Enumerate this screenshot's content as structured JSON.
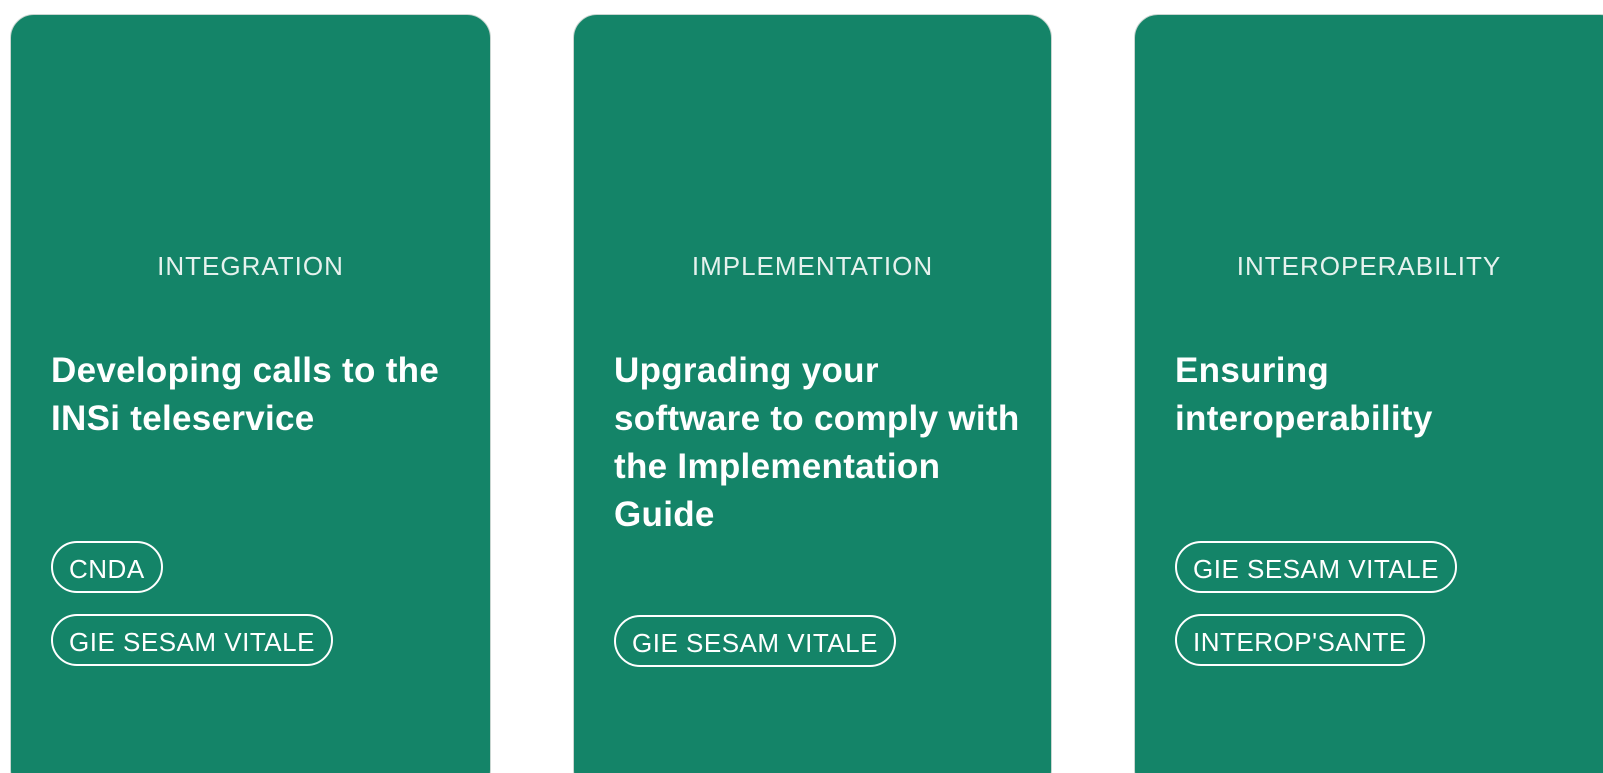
{
  "cards": [
    {
      "category": "INTEGRATION",
      "title": "Developing calls to the INSi teleservice",
      "tags": [
        "CNDA",
        "GIE SESAM VITALE"
      ]
    },
    {
      "category": "IMPLEMENTATION",
      "title": "Upgrading your software to comply with the Implementation Guide",
      "tags": [
        "GIE SESAM VITALE"
      ]
    },
    {
      "category": "INTEROPERABILITY",
      "title": "Ensuring interoperability",
      "tags": [
        "GIE SESAM VITALE",
        "INTEROP'SANTE"
      ]
    }
  ],
  "colors": {
    "card_background": "#148468",
    "text": "#ffffff",
    "page_background": "#ffffff"
  }
}
